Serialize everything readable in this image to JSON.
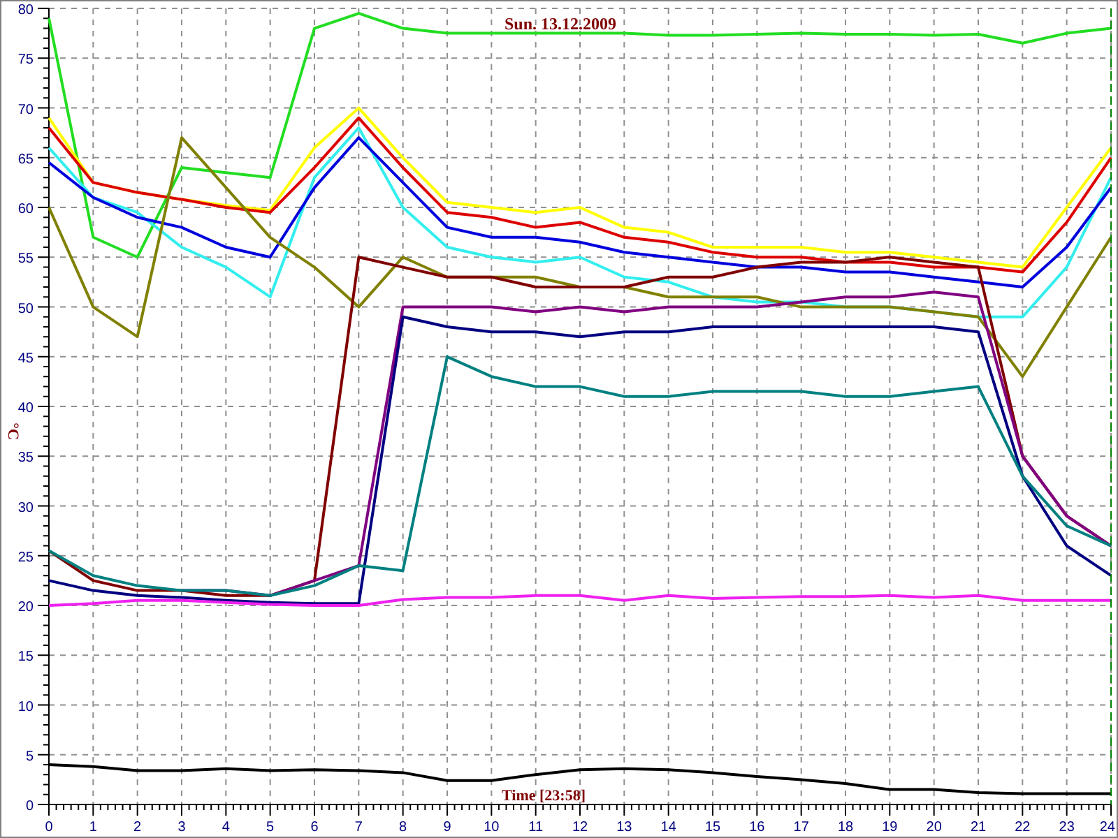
{
  "chart": {
    "chart_data": {
      "type": "line",
      "title": "Sun. 13.12.2009",
      "xlabel": "Time [23:58]",
      "ylabel": "°C",
      "grid": true,
      "x": [
        0,
        1,
        2,
        3,
        4,
        5,
        6,
        7,
        8,
        9,
        10,
        11,
        12,
        13,
        14,
        15,
        16,
        17,
        18,
        19,
        20,
        21,
        22,
        23,
        24
      ],
      "xlim": [
        0,
        24
      ],
      "ylim": [
        0,
        80
      ],
      "xticks": [
        0,
        1,
        2,
        3,
        4,
        5,
        6,
        7,
        8,
        9,
        10,
        11,
        12,
        13,
        14,
        15,
        16,
        17,
        18,
        19,
        20,
        21,
        22,
        23,
        24
      ],
      "yticks": [
        0,
        5,
        10,
        15,
        20,
        25,
        30,
        35,
        40,
        45,
        50,
        55,
        60,
        65,
        70,
        75,
        80
      ],
      "series": [
        {
          "color": "#22dd22",
          "values": [
            79,
            57,
            55,
            64,
            63.5,
            63,
            78,
            79.5,
            78,
            77.5,
            77.5,
            77.5,
            77.5,
            77.5,
            77.3,
            77.3,
            77.4,
            77.5,
            77.4,
            77.4,
            77.3,
            77.4,
            76.5,
            77.5,
            78
          ]
        },
        {
          "color": "#ffff00",
          "values": [
            69,
            62.5,
            61.5,
            60.8,
            60.2,
            59.7,
            66,
            70,
            65,
            60.5,
            60,
            59.5,
            60,
            58,
            57.5,
            56,
            56,
            56,
            55.5,
            55.5,
            55,
            54.5,
            54,
            60,
            66
          ]
        },
        {
          "color": "#dd0000",
          "values": [
            68,
            62.5,
            61.5,
            60.8,
            60,
            59.5,
            64,
            69,
            64,
            59.5,
            59,
            58,
            58.5,
            57,
            56.5,
            55.5,
            55,
            55,
            54.5,
            54.5,
            54,
            54,
            53.5,
            58.5,
            65
          ]
        },
        {
          "color": "#33eeee",
          "values": [
            66,
            61,
            59.5,
            56,
            54,
            51,
            63,
            68,
            60,
            56,
            55,
            54.5,
            55,
            53,
            52.5,
            51,
            50.5,
            50.5,
            50,
            50,
            49.5,
            49,
            49,
            54,
            63
          ]
        },
        {
          "color": "#0000dd",
          "values": [
            64.5,
            61,
            59,
            58,
            56,
            55,
            62,
            67,
            62.5,
            58,
            57,
            57,
            56.5,
            55.5,
            55,
            54.5,
            54,
            54,
            53.5,
            53.5,
            53,
            52.5,
            52,
            56,
            62
          ]
        },
        {
          "color": "#808000",
          "values": [
            60,
            50,
            47,
            67,
            62,
            57,
            54,
            50,
            55,
            53,
            53,
            53,
            52,
            52,
            51,
            51,
            51,
            50,
            50,
            50,
            49.5,
            49,
            43,
            50,
            57
          ]
        },
        {
          "color": "#800000",
          "values": [
            25.5,
            22.5,
            21.5,
            21.5,
            21,
            21,
            22.5,
            55,
            54,
            53,
            53,
            52,
            52,
            52,
            53,
            53,
            54,
            54.5,
            54.5,
            55,
            54.5,
            54,
            35,
            29,
            26
          ]
        },
        {
          "color": "#800080",
          "values": [
            null,
            null,
            null,
            21.5,
            21.5,
            21,
            22.5,
            24,
            50,
            50,
            50,
            49.5,
            50,
            49.5,
            50,
            50,
            50,
            50.5,
            51,
            51,
            51.5,
            51,
            35,
            29,
            26
          ]
        },
        {
          "color": "#000080",
          "values": [
            22.5,
            21.5,
            21,
            20.8,
            20.5,
            20.3,
            20.2,
            20.2,
            49,
            48,
            47.5,
            47.5,
            47,
            47.5,
            47.5,
            48,
            48,
            48,
            48,
            48,
            48,
            47.5,
            33,
            26,
            23
          ]
        },
        {
          "color": "#008080",
          "values": [
            25.5,
            23,
            22,
            21.5,
            21.5,
            21,
            22,
            24,
            23.5,
            45,
            43,
            42,
            42,
            41,
            41,
            41.5,
            41.5,
            41.5,
            41,
            41,
            41.5,
            42,
            33,
            28,
            26
          ]
        },
        {
          "color": "#ee22ee",
          "values": [
            20,
            20.2,
            20.5,
            20.5,
            20.3,
            20.1,
            20,
            20,
            20.6,
            20.8,
            20.8,
            21,
            21,
            20.5,
            21,
            20.7,
            20.8,
            20.9,
            20.9,
            21,
            20.8,
            21,
            20.5,
            20.5,
            20.5
          ]
        },
        {
          "color": "#000000",
          "values": [
            4,
            3.8,
            3.4,
            3.4,
            3.6,
            3.4,
            3.5,
            3.4,
            3.2,
            2.4,
            2.4,
            3,
            3.5,
            3.6,
            3.5,
            3.2,
            2.8,
            2.5,
            2.1,
            1.5,
            1.5,
            1.2,
            1.1,
            1.1,
            1.1
          ]
        }
      ]
    }
  }
}
